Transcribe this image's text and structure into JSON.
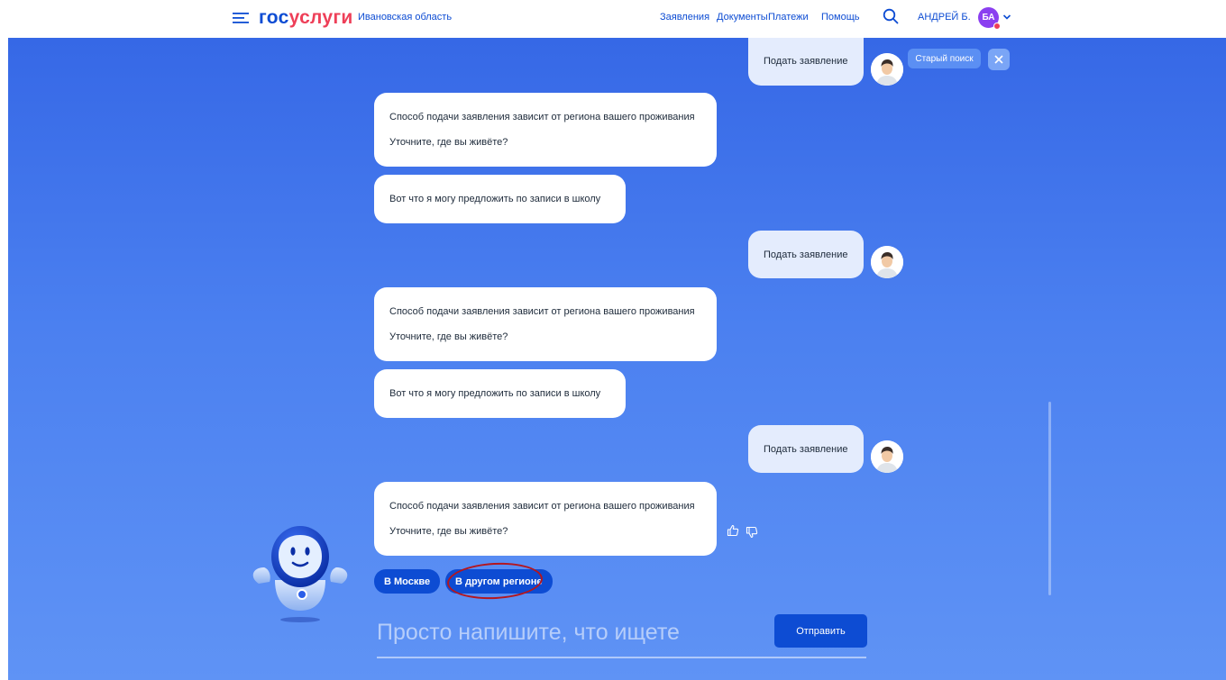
{
  "header": {
    "logo_gos": "гос",
    "logo_uslugi": "услуги",
    "region": "Ивановская область",
    "nav": [
      "Заявления",
      "Документы",
      "Платежи",
      "Помощь"
    ],
    "user_name": "АНДРЕЙ Б.",
    "user_initials": "БА"
  },
  "chat": {
    "old_search": "Старый поиск",
    "messages": [
      {
        "from": "user",
        "text": "Подать заявление"
      },
      {
        "from": "bot",
        "lines": [
          "Способ подачи заявления зависит от региона вашего проживания",
          "Уточните, где вы живёте?"
        ]
      },
      {
        "from": "bot",
        "lines": [
          "Вот что я могу предложить по записи в школу"
        ]
      },
      {
        "from": "user",
        "text": "Подать заявление"
      },
      {
        "from": "bot",
        "lines": [
          "Способ подачи заявления зависит от региона вашего проживания",
          "Уточните, где вы живёте?"
        ]
      },
      {
        "from": "bot",
        "lines": [
          "Вот что я могу предложить по записи в школу"
        ]
      },
      {
        "from": "user",
        "text": "Подать заявление"
      },
      {
        "from": "bot",
        "lines": [
          "Способ подачи заявления зависит от региона вашего проживания",
          "Уточните, где вы живёте?"
        ]
      }
    ],
    "options": [
      "В Москве",
      "В другом регионе"
    ],
    "input_placeholder": "Просто напишите, что ищете",
    "send_label": "Отправить"
  },
  "colors": {
    "brand_blue": "#0d4cd3",
    "brand_red": "#ee3f58",
    "avatar_purple": "#8b3ff0",
    "highlight": "#b4161e"
  }
}
